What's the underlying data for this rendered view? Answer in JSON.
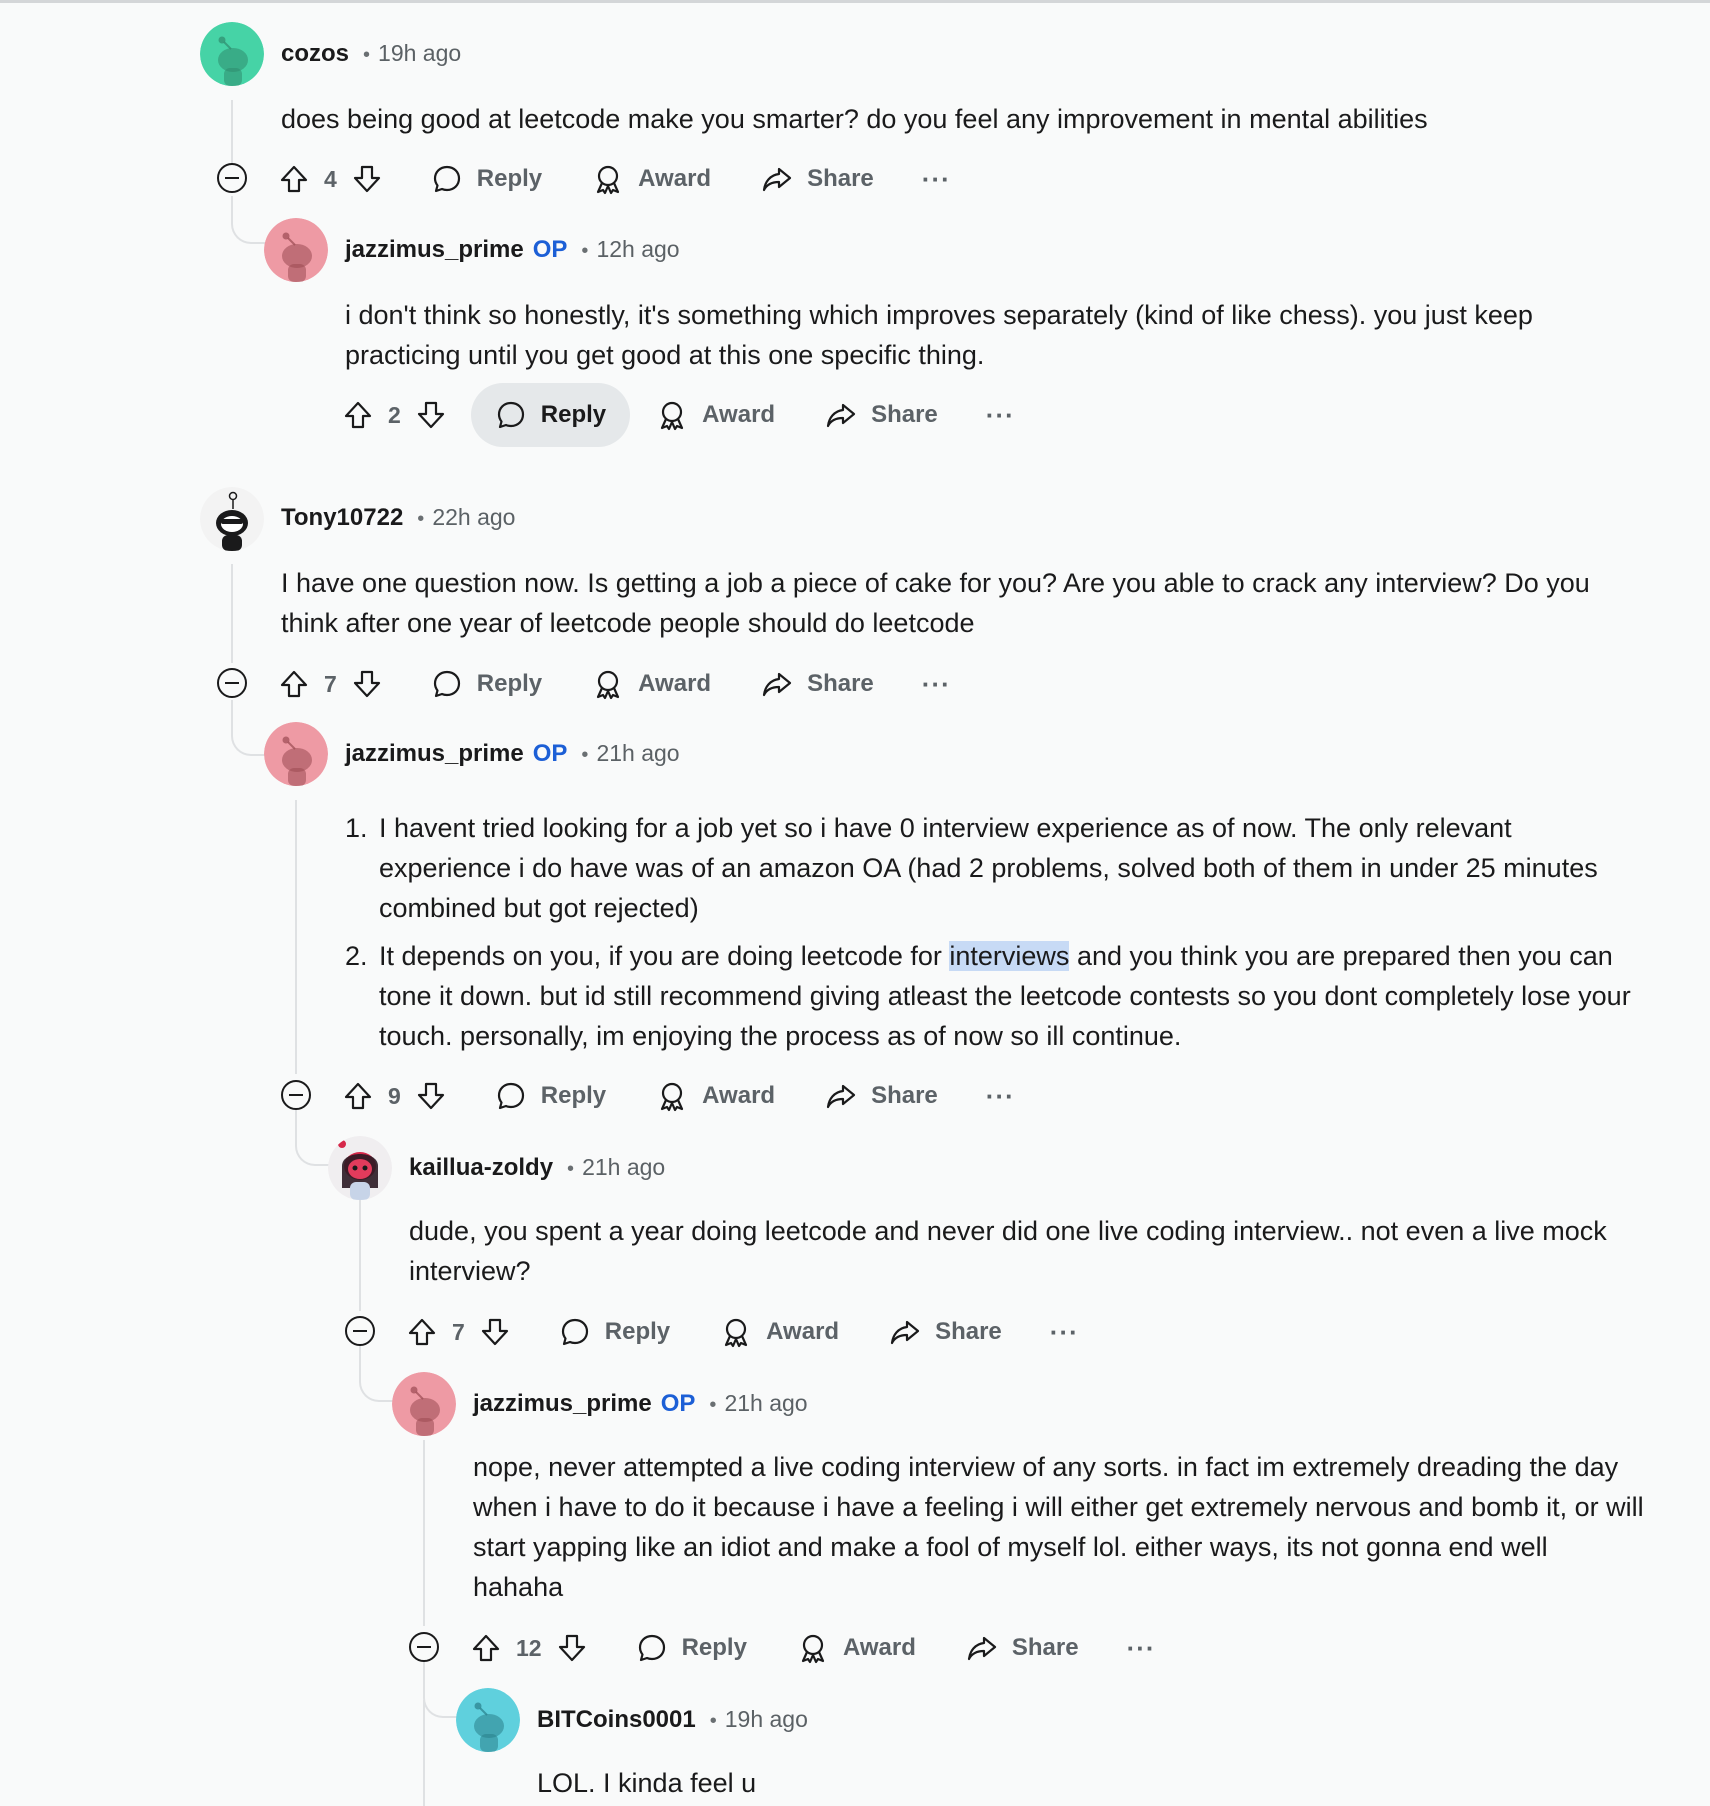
{
  "comments": [
    {
      "author": "cozos",
      "op": "",
      "time": "19h ago",
      "text": "does being good at leetcode make you smarter? do you feel any improvement in mental abilities",
      "score": "4",
      "avatar_color": "#46d3a6",
      "reply_active": false
    },
    {
      "author": "jazzimus_prime",
      "op": "OP",
      "time": "12h ago",
      "text": "i don't think so honestly, it's something which improves separately (kind of like chess). you just keep practicing until you get good at this one specific thing.",
      "score": "2",
      "avatar_color": "#ee9aa4",
      "reply_active": true
    },
    {
      "author": "Tony10722",
      "op": "",
      "time": "22h ago",
      "text": "I have one question now. Is getting a job a piece of cake for you? Are you able to crack any interview? Do you think after one year of leetcode people should do leetcode",
      "score": "7",
      "avatar_color": "#f3f3f3",
      "reply_active": false
    },
    {
      "author": "jazzimus_prime",
      "op": "OP",
      "time": "21h ago",
      "list": [
        "I havent tried looking for a job yet so i have 0 interview experience as of now. The only relevant experience i do have was of an amazon OA (had 2 problems, solved both of them in under 25 minutes combined but got rejected)",
        "It depends on you, if you are doing leetcode for ",
        "interviews",
        " and you think you are prepared then you can tone it down. but id still recommend giving atleast the leetcode contests so you dont completely lose your touch. personally, im enjoying the process as of now so ill continue."
      ],
      "score": "9",
      "avatar_color": "#ee9aa4",
      "reply_active": false
    },
    {
      "author": "kaillua-zoldy",
      "op": "",
      "time": "21h ago",
      "text": "dude, you spent a year doing leetcode and never did one live coding interview.. not even a live mock interview?",
      "score": "7",
      "avatar_color": "#f0eef0",
      "reply_active": false
    },
    {
      "author": "jazzimus_prime",
      "op": "OP",
      "time": "21h ago",
      "text": "nope, never attempted a live coding interview of any sorts. in fact im extremely dreading the day when i have to do it because i have a feeling i will either get extremely nervous and bomb it, or will start yapping like an idiot and make a fool of myself lol. either ways, its not gonna end well hahaha",
      "score": "12",
      "avatar_color": "#ee9aa4",
      "reply_active": false
    },
    {
      "author": "BITCoins0001",
      "op": "",
      "time": "19h ago",
      "text": "LOL. I kinda feel u",
      "avatar_color": "#5fd0dd"
    }
  ],
  "labels": {
    "reply": "Reply",
    "award": "Award",
    "share": "Share",
    "more": "···",
    "dot": "•"
  },
  "colors": {
    "op_badge": "#1c5fd6",
    "highlight": "#c7daf5",
    "muted_text": "#5c6267"
  }
}
